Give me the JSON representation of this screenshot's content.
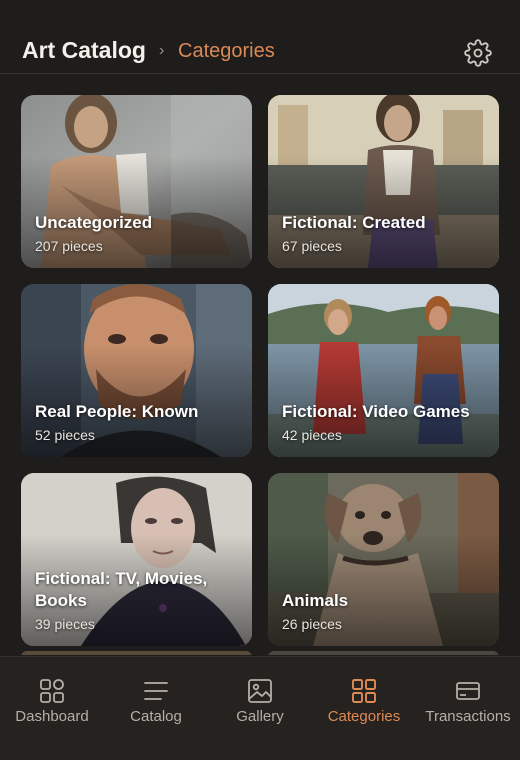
{
  "header": {
    "title": "Art Catalog",
    "separator": "›",
    "breadcrumb": "Categories",
    "settings_icon": "gear-icon"
  },
  "categories": [
    {
      "name": "Uncategorized",
      "count": "207 pieces"
    },
    {
      "name": "Fictional: Created",
      "count": "67 pieces"
    },
    {
      "name": "Real People: Known",
      "count": "52 pieces"
    },
    {
      "name": "Fictional: Video Games",
      "count": "42 pieces"
    },
    {
      "name": "Fictional: TV, Movies, Books",
      "count": "39 pieces"
    },
    {
      "name": "Animals",
      "count": "26 pieces"
    }
  ],
  "tabs": [
    {
      "label": "Dashboard",
      "icon": "dashboard-icon",
      "active": false
    },
    {
      "label": "Catalog",
      "icon": "list-icon",
      "active": false
    },
    {
      "label": "Gallery",
      "icon": "image-icon",
      "active": false
    },
    {
      "label": "Categories",
      "icon": "grid-icon",
      "active": true
    },
    {
      "label": "Transactions",
      "icon": "card-icon",
      "active": false
    }
  ],
  "colors": {
    "background": "#1f1d1b",
    "accent": "#de8a55",
    "inactive": "#b6afa6"
  }
}
